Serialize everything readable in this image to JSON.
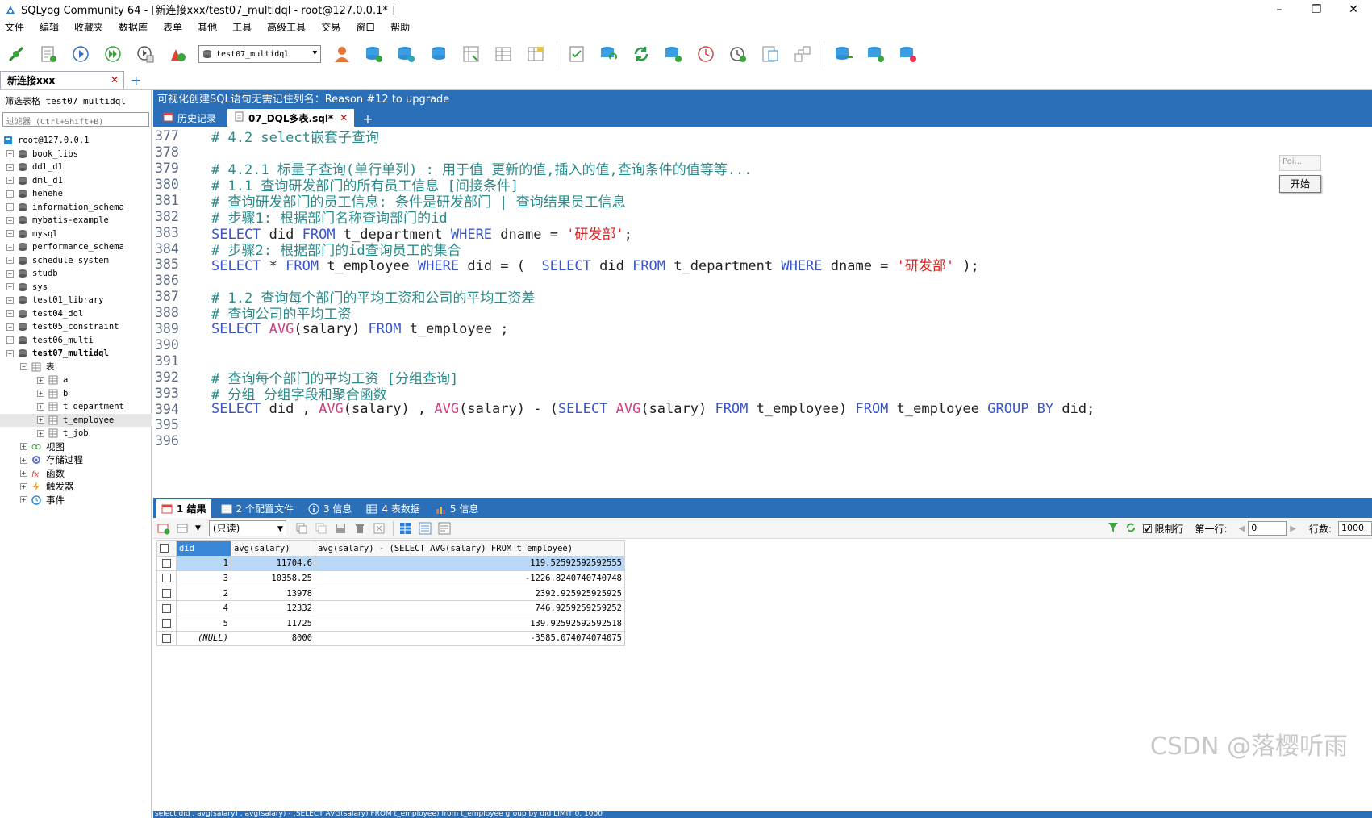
{
  "window": {
    "title": "SQLyog Community 64 - [新连接xxx/test07_multidql - root@127.0.0.1* ]",
    "controls": [
      "–",
      "❐",
      "✕"
    ]
  },
  "menu": [
    "文件",
    "编辑",
    "收藏夹",
    "数据库",
    "表单",
    "其他",
    "工具",
    "高级工具",
    "交易",
    "窗口",
    "帮助"
  ],
  "toolbar": {
    "db_selected": "test07_multidql"
  },
  "connection_tab": {
    "label": "新连接xxx",
    "close": "✕",
    "add": "+"
  },
  "left_panel": {
    "filter_label": "筛选表格 test07_multidql",
    "filter_placeholder": "过滤器 (Ctrl+Shift+B)",
    "root": "root@127.0.0.1",
    "databases": [
      "book_libs",
      "ddl_d1",
      "dml_d1",
      "hehehe",
      "information_schema",
      "mybatis-example",
      "mysql",
      "performance_schema",
      "schedule_system",
      "studb",
      "sys",
      "test01_library",
      "test04_dql",
      "test05_constraint",
      "test06_multi",
      "test07_multidql"
    ],
    "folder_tables": "表",
    "tables": [
      "a",
      "b",
      "t_department",
      "t_employee",
      "t_job"
    ],
    "folders": [
      "视图",
      "存储过程",
      "函数",
      "触发器",
      "事件"
    ]
  },
  "upgrade_bar": "可视化创建SQL语句无需记住列名：Reason #12 to upgrade",
  "query_tabs": {
    "history": "历史记录",
    "active": "07_DQL多表.sql*",
    "close": "✕",
    "add": "+"
  },
  "popup": {
    "tiny": "Poi...",
    "start": "开始"
  },
  "editor_lines": [
    {
      "n": "377",
      "parts": [
        {
          "t": "# 4.2 select嵌套子查询",
          "c": "cm"
        }
      ]
    },
    {
      "n": "378",
      "parts": []
    },
    {
      "n": "379",
      "parts": [
        {
          "t": "# 4.2.1 标量子查询(单行单列) : 用于值 更新的值,插入的值,查询条件的值等等...",
          "c": "cm"
        }
      ]
    },
    {
      "n": "380",
      "parts": [
        {
          "t": "# 1.1 查询研发部门的所有员工信息 [间接条件]",
          "c": "cm"
        }
      ]
    },
    {
      "n": "381",
      "parts": [
        {
          "t": "# 查询研发部门的员工信息: 条件是研发部门 | 查询结果员工信息",
          "c": "cm"
        }
      ]
    },
    {
      "n": "382",
      "parts": [
        {
          "t": "# 步骤1: 根据部门名称查询部门的id",
          "c": "cm"
        }
      ]
    },
    {
      "n": "383",
      "parts": [
        {
          "t": "SELECT",
          "c": "kw"
        },
        {
          "t": " did ",
          "c": "id"
        },
        {
          "t": "FROM",
          "c": "kw"
        },
        {
          "t": " t_department ",
          "c": "id"
        },
        {
          "t": "WHERE",
          "c": "kw"
        },
        {
          "t": " dname = ",
          "c": "id"
        },
        {
          "t": "'研发部'",
          "c": "str"
        },
        {
          "t": ";",
          "c": "id"
        }
      ]
    },
    {
      "n": "384",
      "parts": [
        {
          "t": "# 步骤2: 根据部门的id查询员工的集合",
          "c": "cm"
        }
      ]
    },
    {
      "n": "385",
      "parts": [
        {
          "t": "SELECT",
          "c": "kw"
        },
        {
          "t": " * ",
          "c": "id"
        },
        {
          "t": "FROM",
          "c": "kw"
        },
        {
          "t": " t_employee ",
          "c": "id"
        },
        {
          "t": "WHERE",
          "c": "kw"
        },
        {
          "t": " did = (  ",
          "c": "id"
        },
        {
          "t": "SELECT",
          "c": "kw"
        },
        {
          "t": " did ",
          "c": "id"
        },
        {
          "t": "FROM",
          "c": "kw"
        },
        {
          "t": " t_department ",
          "c": "id"
        },
        {
          "t": "WHERE",
          "c": "kw"
        },
        {
          "t": " dname = ",
          "c": "id"
        },
        {
          "t": "'研发部'",
          "c": "str"
        },
        {
          "t": " );",
          "c": "id"
        }
      ]
    },
    {
      "n": "386",
      "parts": []
    },
    {
      "n": "387",
      "parts": [
        {
          "t": "# 1.2 查询每个部门的平均工资和公司的平均工资差",
          "c": "cm"
        }
      ]
    },
    {
      "n": "388",
      "parts": [
        {
          "t": "# 查询公司的平均工资",
          "c": "cm"
        }
      ]
    },
    {
      "n": "389",
      "parts": [
        {
          "t": "SELECT",
          "c": "kw"
        },
        {
          "t": " ",
          "c": "id"
        },
        {
          "t": "AVG",
          "c": "fn"
        },
        {
          "t": "(salary) ",
          "c": "id"
        },
        {
          "t": "FROM",
          "c": "kw"
        },
        {
          "t": " t_employee ;",
          "c": "id"
        }
      ]
    },
    {
      "n": "390",
      "parts": []
    },
    {
      "n": "391",
      "parts": []
    },
    {
      "n": "392",
      "parts": [
        {
          "t": "# 查询每个部门的平均工资 [分组查询]",
          "c": "cm"
        }
      ]
    },
    {
      "n": "393",
      "parts": [
        {
          "t": "# 分组 分组字段和聚合函数",
          "c": "cm"
        }
      ]
    },
    {
      "n": "394",
      "parts": [
        {
          "t": "SELECT",
          "c": "kw"
        },
        {
          "t": " did , ",
          "c": "id"
        },
        {
          "t": "AVG",
          "c": "fn"
        },
        {
          "t": "(salary) , ",
          "c": "id"
        },
        {
          "t": "AVG",
          "c": "fn"
        },
        {
          "t": "(salary) - (",
          "c": "id"
        },
        {
          "t": "SELECT",
          "c": "kw"
        },
        {
          "t": " ",
          "c": "id"
        },
        {
          "t": "AVG",
          "c": "fn"
        },
        {
          "t": "(salary) ",
          "c": "id"
        },
        {
          "t": "FROM",
          "c": "kw"
        },
        {
          "t": " t_employee) ",
          "c": "id"
        },
        {
          "t": "FROM",
          "c": "kw"
        },
        {
          "t": " t_employee ",
          "c": "id"
        },
        {
          "t": "GROUP BY",
          "c": "kw"
        },
        {
          "t": " did;",
          "c": "id"
        }
      ]
    },
    {
      "n": "395",
      "parts": []
    },
    {
      "n": "396",
      "parts": []
    }
  ],
  "result_tabs": [
    "1 结果",
    "2 个配置文件",
    "3 信息",
    "4 表数据",
    "5 信息"
  ],
  "result_toolbar": {
    "mode": "(只读)",
    "limit_label": "限制行",
    "first_row_label": "第一行:",
    "first_row_value": "0",
    "rows_label": "行数:",
    "rows_value": "1000"
  },
  "result_grid": {
    "columns": [
      "did",
      "avg(salary)",
      "avg(salary) - (SELECT AVG(salary) FROM t_employee)"
    ],
    "rows": [
      [
        "1",
        "11704.6",
        "119.52592592592555"
      ],
      [
        "3",
        "10358.25",
        "-1226.8240740740748"
      ],
      [
        "2",
        "13978",
        "2392.925925925925"
      ],
      [
        "4",
        "12332",
        "746.9259259259252"
      ],
      [
        "5",
        "11725",
        "139.92592592592518"
      ],
      [
        "(NULL)",
        "8000",
        "-3585.074074074075"
      ]
    ]
  },
  "status_text": "select did , avg(salary) , avg(salary) - (SELECT AVG(salary) FROM t_employee) from t_employee group by did LIMIT 0, 1000",
  "watermark": "CSDN @落樱听雨"
}
